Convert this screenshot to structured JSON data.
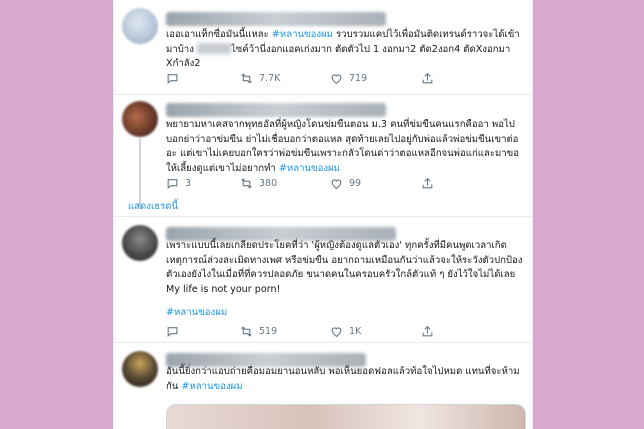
{
  "tweets": [
    {
      "text_before": "เออเอาแท็กซื่อมันนี้แหละ ",
      "hashtag": "#หลานของผม",
      "text_after": " รวบรวมแคปไว้เพื่อมันติดเทรนด์ราวจะได้เข้ามาบ้าง ",
      "text_after2": "ไซค์ว้านี่งอกแอคเก่งมาก ตัดตัวไป 1 งอกมา2 ตัด2งอก4 ตัดXงอกมา Xกำลัง2",
      "replies": "",
      "retweets": "7.7K",
      "likes": "719"
    },
    {
      "text": "พยายามหาเคสจากพุทธอัลที่ผู้หญิงโดนข่มขืนตอน ม.3 คนที่ข่มขืนคนแรกคืออา พอไปบอกย่าว่าอาข่มขืน ย่าไม่เชื่อบอกว่าตอแหล สุดท้ายเลยไปอยู่กับพ่อแล้วพ่อข่มขืนเขาต่ออะ แต่เขาไม่เคยบอกใครว่าพ่อข่มขืนเพราะกลัวโดนด่าว่าตอแหลอีกจนพ่อแก่และมาขอให้เลี้ยงดูแต่เขาไม่อยากทำ ",
      "hashtag": "#หลานของผม",
      "replies": "3",
      "retweets": "380",
      "likes": "99"
    },
    {
      "text": "เพราะแบบนี้เลยเกลียดประโยคที่ว่า 'ผู้หญิงต้องดูแลตัวเอง' ทุกครั้งที่มีคนพูดเวลาเกิดเหตุการณ์ล่วงละเมิดทางเพศ หรือข่มขืน อยากถามเหมือนกันว่าแล้วจะให้ระวังตัวปกป้องตัวเองยังไงในเมื่อที่ที่ควรปลอดภัย ขนาดคนในครอบครัวใกล้ตัวแท้ ๆ ยังไว้ใจไม่ได้เลย My life is not your porn!",
      "hashtag": "#หลานของผม",
      "replies": "",
      "retweets": "519",
      "likes": "1K"
    },
    {
      "text": "อันนี้ยิ่งกว่าแอบถ่ายคือมอมยานอนหลับ พอเห็นยอดฟอลแล้วท้อใจไปหมด แทนที่จะห้ามกัน ",
      "hashtag": "#หลานของผม"
    }
  ],
  "show_thread": "แสดงเธรดนี้",
  "icons": [
    "reply-icon",
    "retweet-icon",
    "like-icon",
    "share-icon"
  ],
  "colors": {
    "link": "#1b95e0",
    "text": "#14171a",
    "muted": "#657786",
    "background": "#d9a8cf"
  }
}
